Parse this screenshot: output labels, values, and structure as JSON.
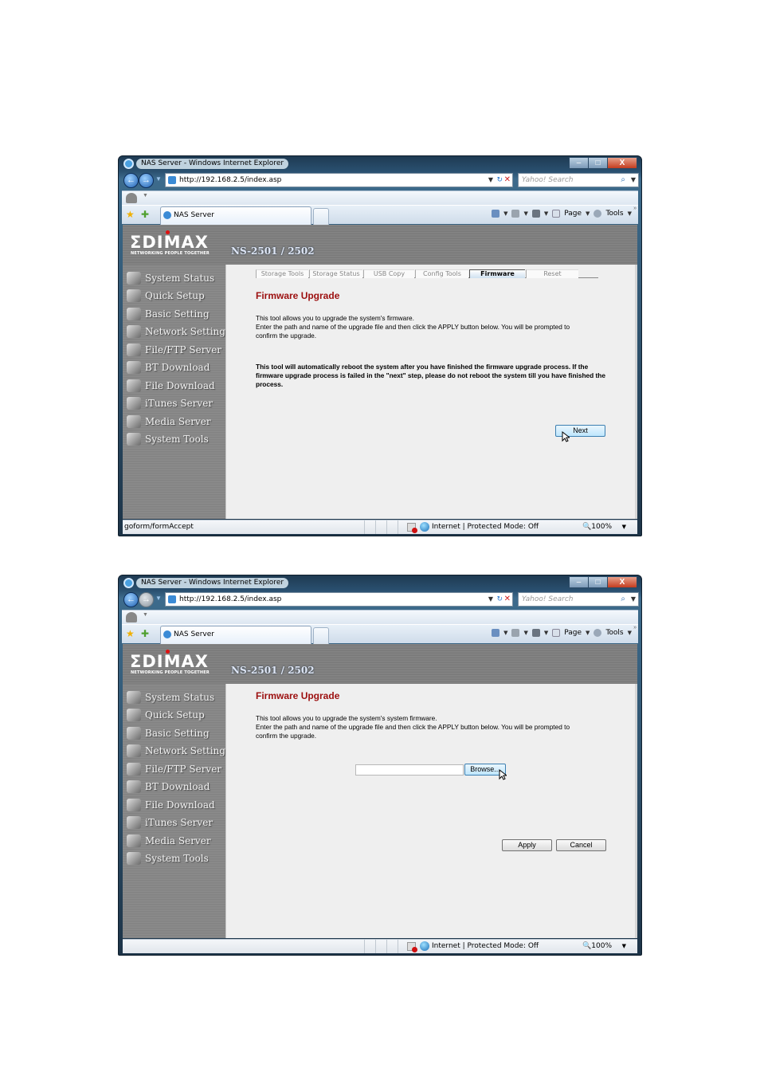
{
  "browser": {
    "window_title": "NAS Server - Windows Internet Explorer",
    "url": "http://192.168.2.5/index.asp",
    "search_placeholder": "Yahoo! Search",
    "tab_title": "NAS Server",
    "toolbar": {
      "page_label": "Page",
      "tools_label": "Tools",
      "more_label": "»"
    },
    "window_controls": {
      "minimize": "–",
      "maximize": "□",
      "close": "X"
    },
    "nav": {
      "back": "←",
      "forward": "→",
      "drop": "▼",
      "refresh": "↻",
      "stop": "✕",
      "search": "⌕"
    },
    "status": {
      "zone": "Internet | Protected Mode: Off",
      "zoom": "100%"
    }
  },
  "app": {
    "brand": "ΣDIMAX",
    "tagline": "NETWORKING PEOPLE TOGETHER",
    "model": "NS-2501 / 2502",
    "accent_color": "#9c0f0f",
    "menu": [
      {
        "label": "System Status",
        "icon": "monitor-icon"
      },
      {
        "label": "Quick Setup",
        "icon": "quick-setup-icon"
      },
      {
        "label": "Basic Setting",
        "icon": "basic-setting-icon"
      },
      {
        "label": "Network Setting",
        "icon": "network-icon"
      },
      {
        "label": "File/FTP Server",
        "icon": "file-server-icon"
      },
      {
        "label": "BT Download",
        "icon": "bt-download-icon"
      },
      {
        "label": "File Download",
        "icon": "file-download-icon"
      },
      {
        "label": "iTunes Server",
        "icon": "itunes-icon"
      },
      {
        "label": "Media Server",
        "icon": "media-server-icon"
      },
      {
        "label": "System Tools",
        "icon": "system-tools-icon"
      }
    ]
  },
  "screen1": {
    "subtabs": [
      {
        "label": "Storage Tools",
        "active": false
      },
      {
        "label": "Storage Status",
        "active": false
      },
      {
        "label": "USB Copy",
        "active": false
      },
      {
        "label": "Config Tools",
        "active": false
      },
      {
        "label": "Firmware",
        "active": true
      },
      {
        "label": "Reset",
        "active": false
      }
    ],
    "title": "Firmware Upgrade",
    "intro_line1": "This tool allows you to upgrade the system's firmware.",
    "intro_line2": "Enter the path and name of the upgrade file and then click the APPLY button below. You will be prompted to confirm the upgrade.",
    "warning": "This tool will automatically reboot the system after you have finished the firmware upgrade process. If the firmware upgrade process is failed in the \"next\" step, please do not reboot the system till you have finished the process.",
    "next_label": "Next",
    "status_text": "goform/formAccept"
  },
  "screen2": {
    "title": "Firmware Upgrade",
    "intro_line1": "This tool allows you to upgrade the system's system firmware.",
    "intro_line2": "Enter the path and name of the upgrade file and then click the APPLY button below. You will be prompted to confirm the upgrade.",
    "file_value": "",
    "browse_label": "Browse...",
    "apply_label": "Apply",
    "cancel_label": "Cancel",
    "status_text": ""
  }
}
